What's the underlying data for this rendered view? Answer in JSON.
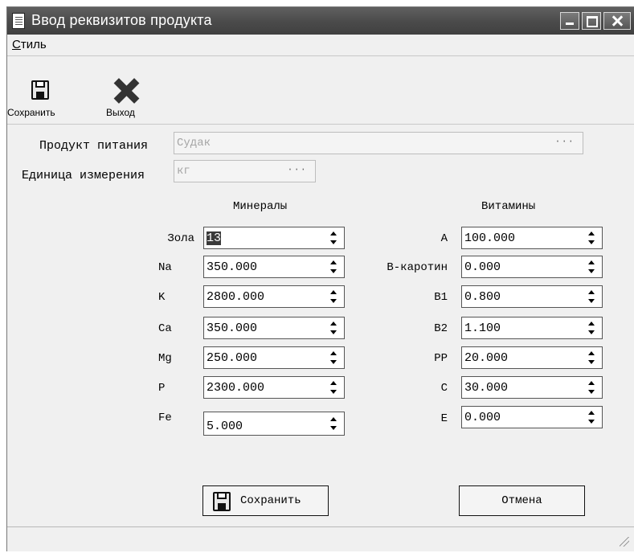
{
  "window": {
    "title": "Ввод реквизитов продукта"
  },
  "menu": {
    "style_underline": "С",
    "style_rest": "тиль"
  },
  "toolbar": {
    "save_label": "Сохранить",
    "exit_label": "Выход"
  },
  "product": {
    "label": "Продукт питания",
    "value": "Судак",
    "dots": "···",
    "unit_label": "Единица измерения",
    "unit_value": "кг",
    "unit_dots": "···"
  },
  "minerals": {
    "heading": "Минералы",
    "items": [
      {
        "label": "Зола",
        "value": "13",
        "selected": true
      },
      {
        "label": "Na",
        "value": "350.000"
      },
      {
        "label": "K",
        "value": "2800.000"
      },
      {
        "label": "Ca",
        "value": "350.000"
      },
      {
        "label": "Mg",
        "value": "250.000"
      },
      {
        "label": "P",
        "value": "2300.000"
      },
      {
        "label": "Fe",
        "value": "5.000"
      }
    ]
  },
  "vitamins": {
    "heading": "Витамины",
    "items": [
      {
        "label": "A",
        "value": "100.000"
      },
      {
        "label": "B-каротин",
        "value": "0.000"
      },
      {
        "label": "B1",
        "value": "0.800"
      },
      {
        "label": "B2",
        "value": "1.100"
      },
      {
        "label": "PP",
        "value": "20.000"
      },
      {
        "label": "C",
        "value": "30.000"
      },
      {
        "label": "E",
        "value": "0.000"
      }
    ]
  },
  "buttons": {
    "save": "Сохранить",
    "cancel": "Отмена"
  }
}
